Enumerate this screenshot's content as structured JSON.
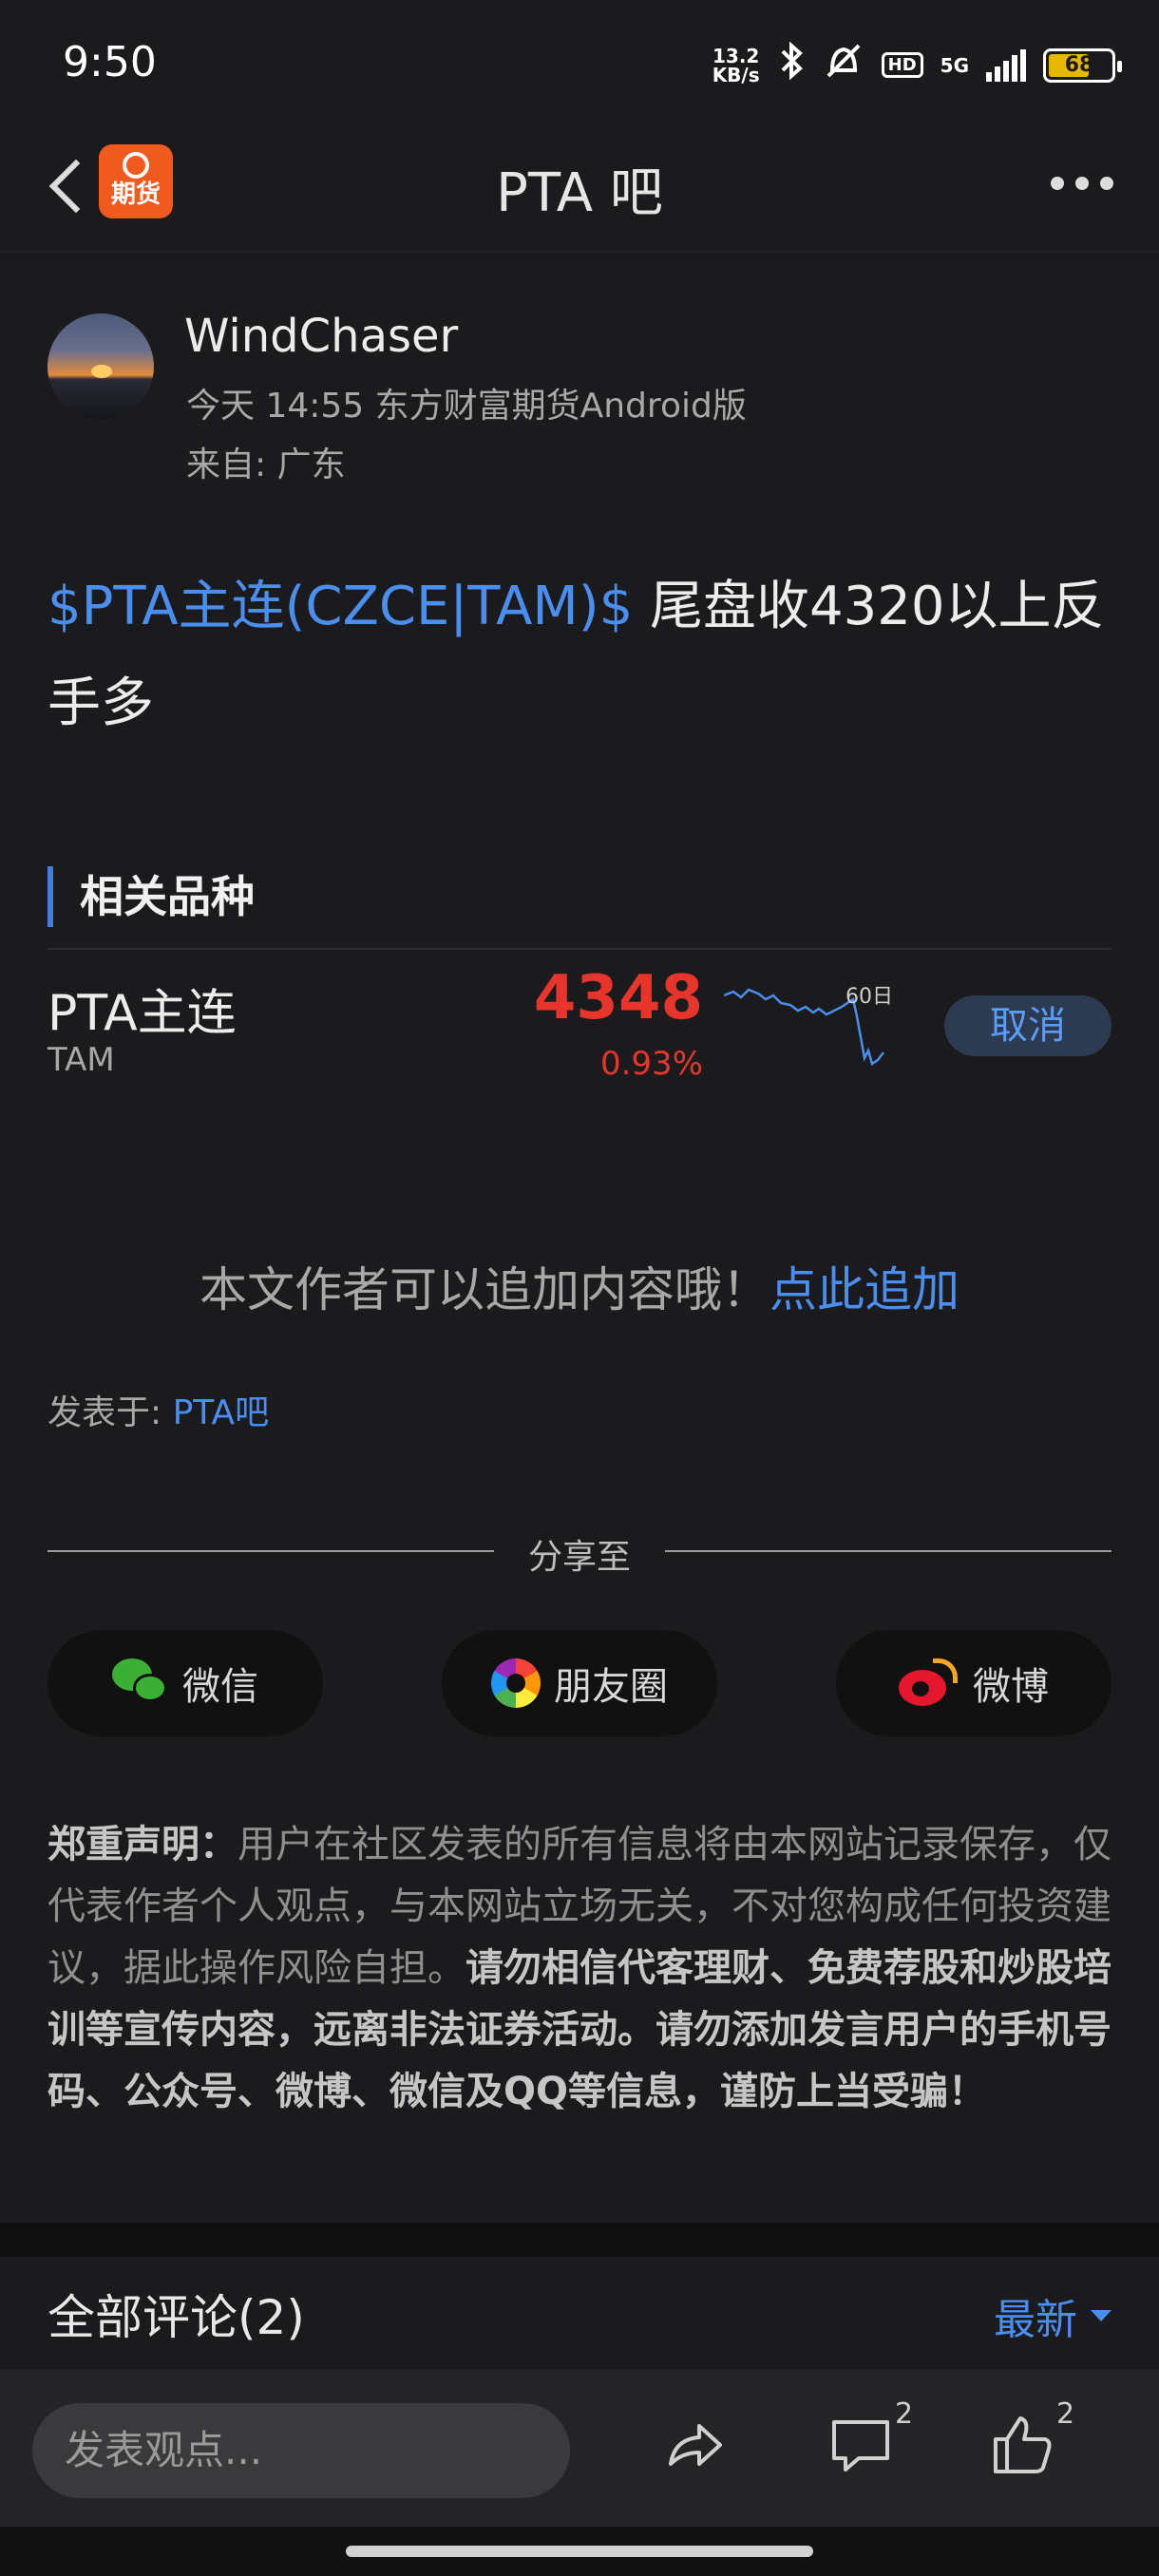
{
  "status_bar": {
    "time": "9:50",
    "net_speed_value": "13.2",
    "net_speed_unit": "KB/s",
    "hd_label": "HD",
    "network": "5G",
    "battery": "68"
  },
  "header": {
    "logo_text": "期货",
    "title": "PTA 吧"
  },
  "author": {
    "name": "WindChaser",
    "meta": "今天 14:55 东方财富期货Android版",
    "location": "来自: 广东"
  },
  "post": {
    "tag": "$PTA主连(CZCE|TAM)$",
    "text": " 尾盘收4320以上反手多"
  },
  "related": {
    "title": "相关品种",
    "item": {
      "name": "PTA主连",
      "code": "TAM",
      "price": "4348",
      "change": "0.93%",
      "chart_label": "60日",
      "button": "取消"
    }
  },
  "append": {
    "text": "本文作者可以追加内容哦！",
    "link": "点此追加"
  },
  "posted_in": {
    "label": "发表于: ",
    "link": "PTA吧"
  },
  "share": {
    "title": "分享至",
    "wechat": "微信",
    "moments": "朋友圈",
    "weibo": "微博"
  },
  "disclaimer": {
    "label": "郑重声明",
    "colon": "：",
    "normal": "用户在社区发表的所有信息将由本网站记录保存，仅代表作者个人观点，与本网站立场无关，不对您构成任何投资建议，据此操作风险自担。",
    "bold": "请勿相信代客理财、免费荐股和炒股培训等宣传内容，远离非法证券活动。请勿添加发言用户的手机号码、公众号、微博、微信及QQ等信息，谨防上当受骗！"
  },
  "comments": {
    "title": "全部评论(2)",
    "sort": "最新"
  },
  "bottom_bar": {
    "input_placeholder": "发表观点...",
    "comment_count": "2",
    "like_count": "2"
  },
  "icons": {
    "back": "chevron-left-icon",
    "more": "more-dots-icon",
    "share": "share-arrow-icon",
    "comment": "comment-bubble-icon",
    "like": "thumbs-up-icon"
  }
}
